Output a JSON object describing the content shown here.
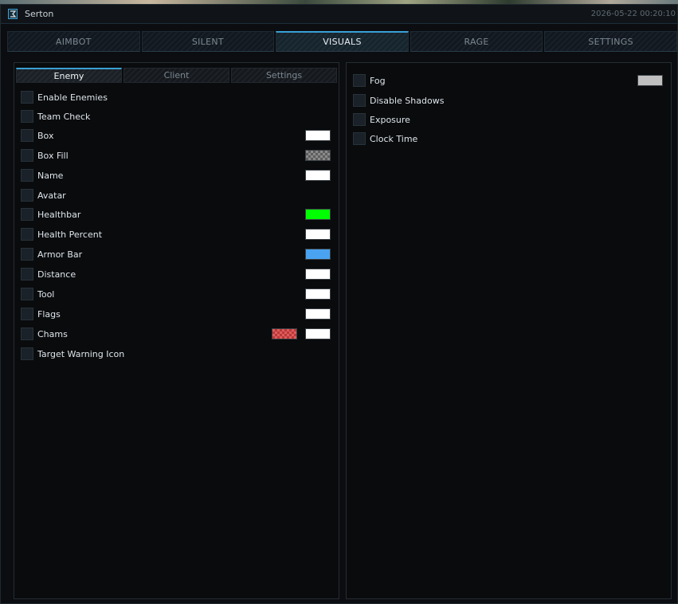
{
  "window": {
    "title": "Serton",
    "logo_icon": "sigma-icon",
    "timestamp": "2026-05-22 00:20:10"
  },
  "main_tabs": [
    {
      "label": "AIMBOT",
      "active": false
    },
    {
      "label": "SILENT",
      "active": false
    },
    {
      "label": "VISUALS",
      "active": true
    },
    {
      "label": "RAGE",
      "active": false
    },
    {
      "label": "SETTINGS",
      "active": false
    }
  ],
  "left_panel": {
    "subtabs": [
      {
        "label": "Enemy",
        "active": true
      },
      {
        "label": "Client",
        "active": false
      },
      {
        "label": "Settings",
        "active": false
      }
    ],
    "options": [
      {
        "label": "Enable Enemies",
        "checked": false
      },
      {
        "label": "Team Check",
        "checked": false
      },
      {
        "label": "Box",
        "checked": false,
        "color": "#ffffff"
      },
      {
        "label": "Box Fill",
        "checked": false,
        "color": "#808080"
      },
      {
        "label": "Name",
        "checked": false,
        "color": "#ffffff"
      },
      {
        "label": "Avatar",
        "checked": false
      },
      {
        "label": "Healthbar",
        "checked": false,
        "color": "#00ff00"
      },
      {
        "label": "Health Percent",
        "checked": false,
        "color": "#ffffff"
      },
      {
        "label": "Armor Bar",
        "checked": false,
        "color": "#4aa3f0"
      },
      {
        "label": "Distance",
        "checked": false,
        "color": "#ffffff"
      },
      {
        "label": "Tool",
        "checked": false,
        "color": "#ffffff"
      },
      {
        "label": "Flags",
        "checked": false,
        "color": "#ffffff"
      },
      {
        "label": "Chams",
        "checked": false,
        "color": "#e05a5a",
        "color2": "#ffffff"
      },
      {
        "label": "Target Warning Icon",
        "checked": false
      }
    ]
  },
  "right_panel": {
    "options": [
      {
        "label": "Fog",
        "checked": false,
        "color": "#c0c0c0"
      },
      {
        "label": "Disable Shadows",
        "checked": false
      },
      {
        "label": "Exposure",
        "checked": false
      },
      {
        "label": "Clock Time",
        "checked": false
      }
    ]
  },
  "colors": {
    "accent": "#3aa0d6",
    "background": "#0b0d10"
  }
}
